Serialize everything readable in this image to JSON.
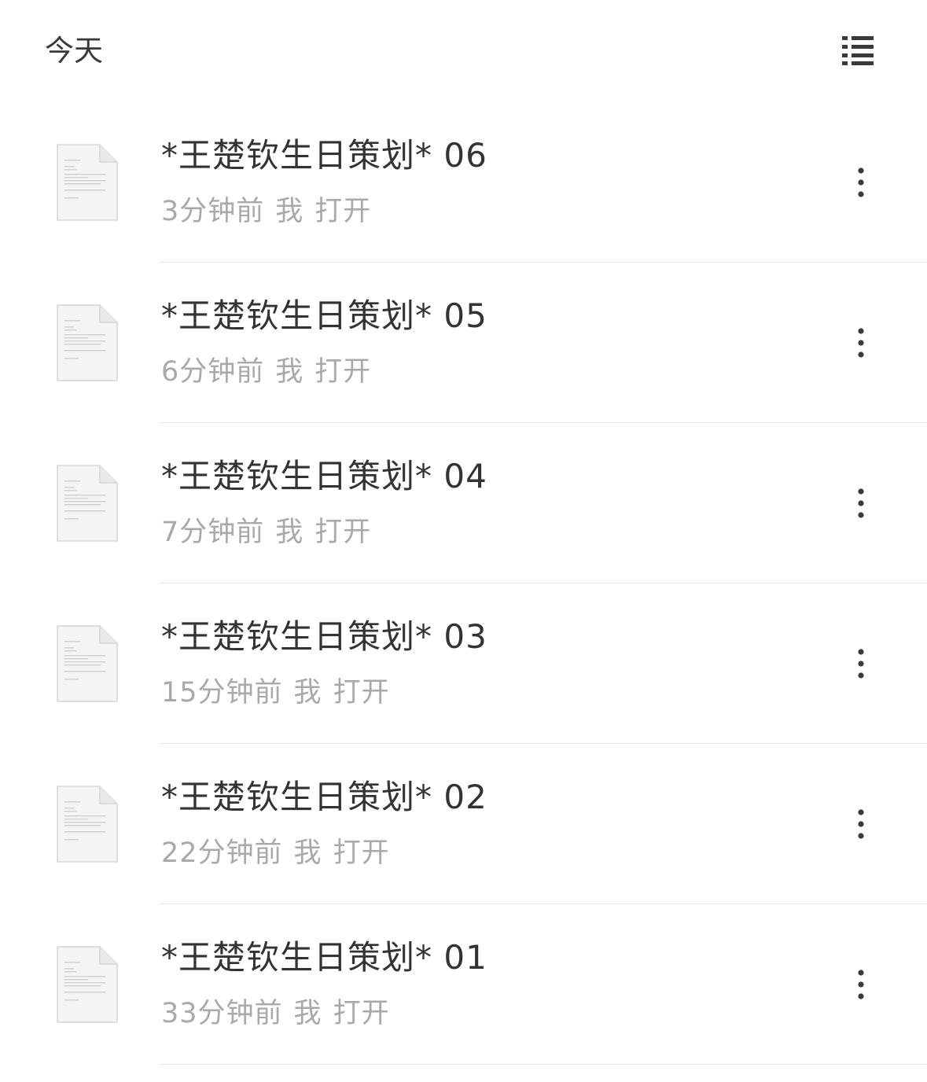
{
  "header": {
    "title": "今天",
    "view_toggle_icon": "list-view-icon"
  },
  "files": [
    {
      "name": "*王楚钦生日策划*  06",
      "time": "3分钟前",
      "owner": "我",
      "action": "打开"
    },
    {
      "name": "*王楚钦生日策划*  05",
      "time": "6分钟前",
      "owner": "我",
      "action": "打开"
    },
    {
      "name": "*王楚钦生日策划*  04",
      "time": "7分钟前",
      "owner": "我",
      "action": "打开"
    },
    {
      "name": "*王楚钦生日策划*  03",
      "time": "15分钟前",
      "owner": "我",
      "action": "打开"
    },
    {
      "name": "*王楚钦生日策划*  02",
      "time": "22分钟前",
      "owner": "我",
      "action": "打开"
    },
    {
      "name": "*王楚钦生日策划*  01",
      "time": "33分钟前",
      "owner": "我",
      "action": "打开"
    }
  ],
  "icons": {
    "file": "document-icon",
    "more": "more-vertical-icon"
  },
  "colors": {
    "title_text": "#333333",
    "meta_text": "#a9a9a9",
    "divider": "#e4e4e4",
    "icon": "#3a3a3a"
  }
}
